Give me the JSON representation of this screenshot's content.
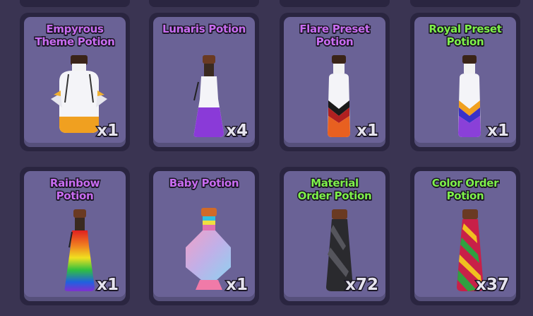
{
  "inventory": {
    "items": [
      {
        "name": "Empyrous Theme Potion",
        "title_lines": [
          "Empyrous",
          "Theme Potion"
        ],
        "count": "x1",
        "title_color": "#c86cf0",
        "icon": "empyrous-potion-icon"
      },
      {
        "name": "Lunaris Potion",
        "title_lines": [
          "Lunaris Potion",
          ""
        ],
        "count": "x4",
        "title_color": "#c86cf0",
        "icon": "lunaris-potion-icon"
      },
      {
        "name": "Flare Preset Potion",
        "title_lines": [
          "Flare Preset",
          "Potion"
        ],
        "count": "x1",
        "title_color": "#c86cf0",
        "icon": "flare-preset-potion-icon"
      },
      {
        "name": "Royal Preset Potion",
        "title_lines": [
          "Royal Preset",
          "Potion"
        ],
        "count": "x1",
        "title_color": "#7ef04a",
        "icon": "royal-preset-potion-icon"
      },
      {
        "name": "Rainbow Potion",
        "title_lines": [
          "Rainbow",
          "Potion"
        ],
        "count": "x1",
        "title_color": "#c86cf0",
        "icon": "rainbow-potion-icon"
      },
      {
        "name": "Baby Potion",
        "title_lines": [
          "Baby Potion",
          ""
        ],
        "count": "x1",
        "title_color": "#c86cf0",
        "icon": "baby-potion-icon"
      },
      {
        "name": "Material Order Potion",
        "title_lines": [
          "Material",
          "Order Potion"
        ],
        "count": "x72",
        "title_color": "#7ef04a",
        "icon": "material-order-potion-icon"
      },
      {
        "name": "Color Order Potion",
        "title_lines": [
          "Color Order",
          "Potion"
        ],
        "count": "x37",
        "title_color": "#7ef04a",
        "icon": "color-order-potion-icon"
      }
    ]
  }
}
